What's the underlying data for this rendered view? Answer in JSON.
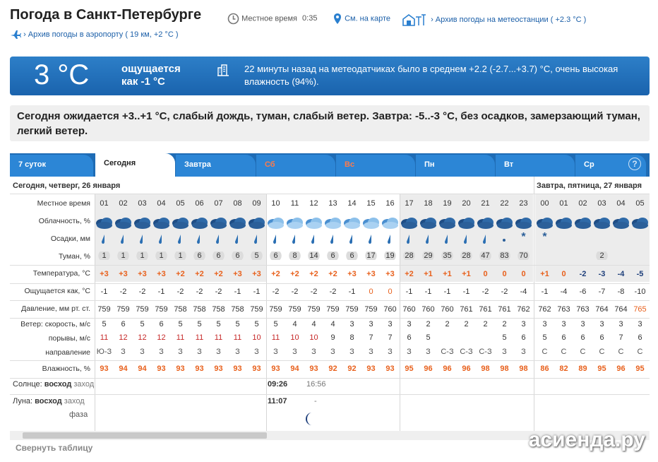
{
  "header": {
    "title": "Погода в Санкт-Петербурге",
    "local_time_label": "Местное время",
    "local_time": "0:35",
    "map_link": "См. на карте",
    "station_archive_link": "Архив погоды на метеостанции",
    "station_archive_temp": "( +2.3 °C )",
    "airport_archive_link": "Архив погоды в аэропорту",
    "airport_archive_info": "( 19 км, +2 °C )"
  },
  "current": {
    "temp": "3 °C",
    "feels_label": "ощущается",
    "feels_value": "как -1 °C",
    "sensor_text": "22 минуты назад на метеодатчиках было в среднем +2.2 (-2.7...+3.7) °C, очень высокая влажность (94%)."
  },
  "forecast_text": "Сегодня ожидается +3..+1 °C, слабый дождь, туман, слабый ветер. Завтра: -5..-3 °C, без осадков, замерзающий туман, легкий ветер.",
  "tabs": [
    {
      "label": "7 суток",
      "active": false,
      "weekend": false
    },
    {
      "label": "Сегодня",
      "active": true,
      "weekend": false
    },
    {
      "label": "Завтра",
      "active": false,
      "weekend": false
    },
    {
      "label": "Сб",
      "active": false,
      "weekend": true
    },
    {
      "label": "Вс",
      "active": false,
      "weekend": true
    },
    {
      "label": "Пн",
      "active": false,
      "weekend": false
    },
    {
      "label": "Вт",
      "active": false,
      "weekend": false
    },
    {
      "label": "Ср",
      "active": false,
      "weekend": false
    }
  ],
  "help_label": "?",
  "table": {
    "day1": "Сегодня, четверг, 26 января",
    "day2": "Завтра, пятница, 27 января",
    "row_labels": {
      "time": "Местное время",
      "clouds": "Облачность, %",
      "precip": "Осадки, мм",
      "fog": "Туман, %",
      "temp": "Температура, °C",
      "feels": "Ощущается как, °C",
      "pressure": "Давление, мм рт. ст.",
      "wind_speed": "Ветер: скорость, м/с",
      "gusts": "порывы, м/с",
      "direction": "направление",
      "humidity": "Влажность, %",
      "sun_prefix": "Солнце:",
      "sunrise_label": "восход",
      "sunset_label": "заход",
      "moon_prefix": "Луна:",
      "moonrise_label": "восход",
      "moonset_label": "заход",
      "phase_label": "фаза"
    },
    "hours": [
      "01",
      "02",
      "03",
      "04",
      "05",
      "06",
      "07",
      "08",
      "09",
      "10",
      "11",
      "12",
      "13",
      "14",
      "15",
      "16",
      "17",
      "18",
      "19",
      "20",
      "21",
      "22",
      "23",
      "00",
      "01",
      "02",
      "03",
      "04",
      "05"
    ],
    "fog": [
      "1",
      "1",
      "1",
      "1",
      "1",
      "6",
      "6",
      "6",
      "5",
      "6",
      "8",
      "14",
      "6",
      "6",
      "17",
      "19",
      "28",
      "29",
      "35",
      "28",
      "47",
      "83",
      "70",
      "",
      "",
      "",
      "2",
      "",
      ""
    ],
    "temp": [
      "+3",
      "+3",
      "+3",
      "+3",
      "+2",
      "+2",
      "+2",
      "+3",
      "+3",
      "+2",
      "+2",
      "+2",
      "+2",
      "+3",
      "+3",
      "+3",
      "+2",
      "+1",
      "+1",
      "+1",
      "0",
      "0",
      "0",
      "+1",
      "0",
      "-2",
      "-3",
      "-4",
      "-5"
    ],
    "feels": [
      "-1",
      "-2",
      "-2",
      "-1",
      "-2",
      "-2",
      "-2",
      "-1",
      "-1",
      "-2",
      "-2",
      "-2",
      "-2",
      "-1",
      "0",
      "0",
      "-1",
      "-1",
      "-1",
      "-1",
      "-2",
      "-2",
      "-4",
      "-1",
      "-4",
      "-6",
      "-7",
      "-8",
      "-10"
    ],
    "pressure": [
      "759",
      "759",
      "759",
      "759",
      "758",
      "758",
      "758",
      "758",
      "759",
      "759",
      "759",
      "759",
      "759",
      "759",
      "759",
      "760",
      "760",
      "760",
      "760",
      "761",
      "761",
      "761",
      "762",
      "762",
      "763",
      "763",
      "764",
      "764",
      "765"
    ],
    "wind_speed": [
      "5",
      "6",
      "5",
      "6",
      "5",
      "5",
      "5",
      "5",
      "5",
      "5",
      "4",
      "4",
      "4",
      "3",
      "3",
      "3",
      "3",
      "2",
      "2",
      "2",
      "2",
      "2",
      "3",
      "3",
      "3",
      "3",
      "3",
      "3",
      "3"
    ],
    "gusts": [
      "11",
      "12",
      "12",
      "12",
      "11",
      "11",
      "11",
      "11",
      "10",
      "11",
      "10",
      "10",
      "9",
      "8",
      "7",
      "7",
      "6",
      "5",
      "",
      "",
      "",
      "5",
      "6",
      "5",
      "6",
      "6",
      "6",
      "7",
      "6"
    ],
    "direction": [
      "Ю-З",
      "З",
      "З",
      "З",
      "З",
      "З",
      "З",
      "З",
      "З",
      "З",
      "З",
      "З",
      "З",
      "З",
      "З",
      "З",
      "З",
      "З",
      "С-З",
      "С-З",
      "С-З",
      "З",
      "З",
      "С",
      "С",
      "С",
      "С",
      "С",
      "С"
    ],
    "humidity": [
      "93",
      "94",
      "94",
      "93",
      "93",
      "93",
      "93",
      "93",
      "93",
      "93",
      "94",
      "93",
      "92",
      "92",
      "93",
      "93",
      "95",
      "96",
      "96",
      "96",
      "98",
      "98",
      "98",
      "86",
      "82",
      "89",
      "95",
      "96",
      "95"
    ],
    "precip": [
      "r",
      "r",
      "r",
      "r",
      "r",
      "r",
      "r",
      "r",
      "r",
      "r",
      "r",
      "r",
      "r",
      "r",
      "r",
      "r",
      "r",
      "r",
      "r",
      "r",
      "r",
      "d",
      "s",
      "s",
      "",
      "",
      "",
      "",
      ""
    ],
    "sunrise": "09:26",
    "sunset": "16:56",
    "moonrise": "11:07",
    "moonset": "-",
    "temp_colors": {
      "warm": "#e8601c",
      "cold": "#1d3e7a",
      "zero": "#e8601c"
    }
  },
  "collapse_label": "Свернуть таблицу",
  "watermark": "асиенда.ру"
}
